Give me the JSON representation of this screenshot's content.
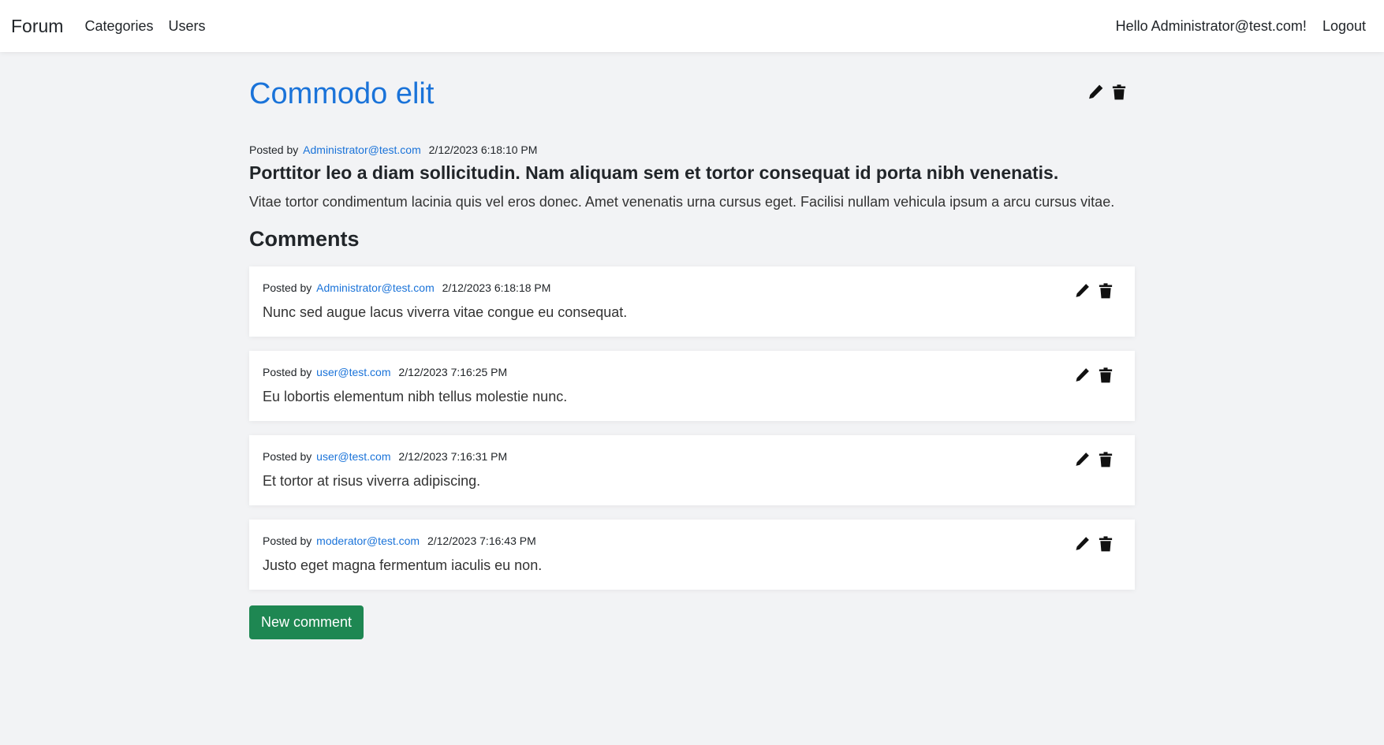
{
  "navbar": {
    "brand": "Forum",
    "links": [
      {
        "label": "Categories"
      },
      {
        "label": "Users"
      }
    ],
    "greeting": "Hello Administrator@test.com!",
    "logout": "Logout"
  },
  "post": {
    "title": "Commodo elit",
    "posted_by_label": "Posted by",
    "author": "Administrator@test.com",
    "timestamp": "2/12/2023 6:18:10 PM",
    "subtitle": "Porttitor leo a diam sollicitudin. Nam aliquam sem et tortor consequat id porta nibh venenatis.",
    "body": "Vitae tortor condimentum lacinia quis vel eros donec. Amet venenatis urna cursus eget. Facilisi nullam vehicula ipsum a arcu cursus vitae."
  },
  "comments_heading": "Comments",
  "comments": [
    {
      "posted_by_label": "Posted by",
      "author": "Administrator@test.com",
      "timestamp": "2/12/2023 6:18:18 PM",
      "text": "Nunc sed augue lacus viverra vitae congue eu consequat."
    },
    {
      "posted_by_label": "Posted by",
      "author": "user@test.com",
      "timestamp": "2/12/2023 7:16:25 PM",
      "text": "Eu lobortis elementum nibh tellus molestie nunc."
    },
    {
      "posted_by_label": "Posted by",
      "author": "user@test.com",
      "timestamp": "2/12/2023 7:16:31 PM",
      "text": "Et tortor at risus viverra adipiscing."
    },
    {
      "posted_by_label": "Posted by",
      "author": "moderator@test.com",
      "timestamp": "2/12/2023 7:16:43 PM",
      "text": "Justo eget magna fermentum iaculis eu non."
    }
  ],
  "new_comment_label": "New comment",
  "icons": {
    "edit": "pencil-icon",
    "delete": "trash-icon"
  },
  "colors": {
    "link": "#1a73d9",
    "primary_button": "#1e8752",
    "background": "#f2f3f5"
  }
}
